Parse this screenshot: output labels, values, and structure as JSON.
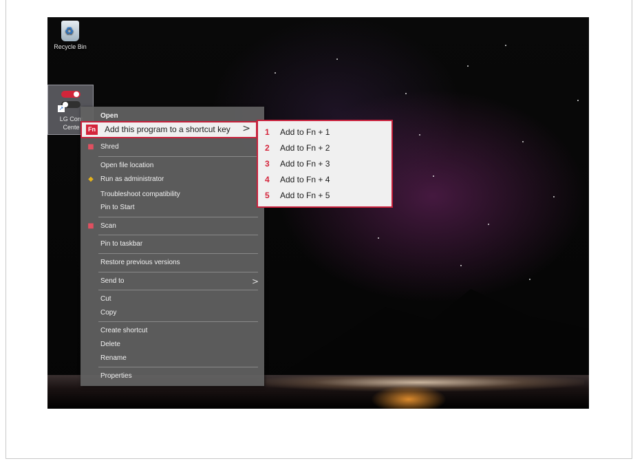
{
  "desktop": {
    "icons": {
      "recycle_bin": {
        "label": "Recycle Bin",
        "icon": "recycle-bin-icon"
      },
      "lg_control_center": {
        "label_line1": "LG Cont",
        "label_line2": "Cente",
        "icon": "lg-control-center-icon"
      }
    }
  },
  "context_menu": {
    "open": "Open",
    "add_shortcut": {
      "badge": "Fn",
      "label": "Add this program to a shortcut key",
      "arrow": ">"
    },
    "shred": "Shred",
    "open_file_location": "Open file location",
    "run_as_admin": "Run as administrator",
    "troubleshoot": "Troubleshoot compatibility",
    "pin_to_start": "Pin to Start",
    "scan": "Scan",
    "pin_to_taskbar": "Pin to taskbar",
    "restore_versions": "Restore previous versions",
    "send_to": {
      "label": "Send to",
      "arrow": ">"
    },
    "cut": "Cut",
    "copy": "Copy",
    "create_shortcut": "Create shortcut",
    "delete": "Delete",
    "rename": "Rename",
    "properties": "Properties"
  },
  "submenu": {
    "items": [
      {
        "num": "1",
        "label": "Add to Fn + 1"
      },
      {
        "num": "2",
        "label": "Add to Fn + 2"
      },
      {
        "num": "3",
        "label": "Add to Fn + 3"
      },
      {
        "num": "4",
        "label": "Add to Fn + 4"
      },
      {
        "num": "5",
        "label": "Add to Fn + 5"
      }
    ]
  },
  "colors": {
    "highlight": "#c8213c",
    "accent_red": "#d4243b",
    "menu_bg": "#626262"
  }
}
